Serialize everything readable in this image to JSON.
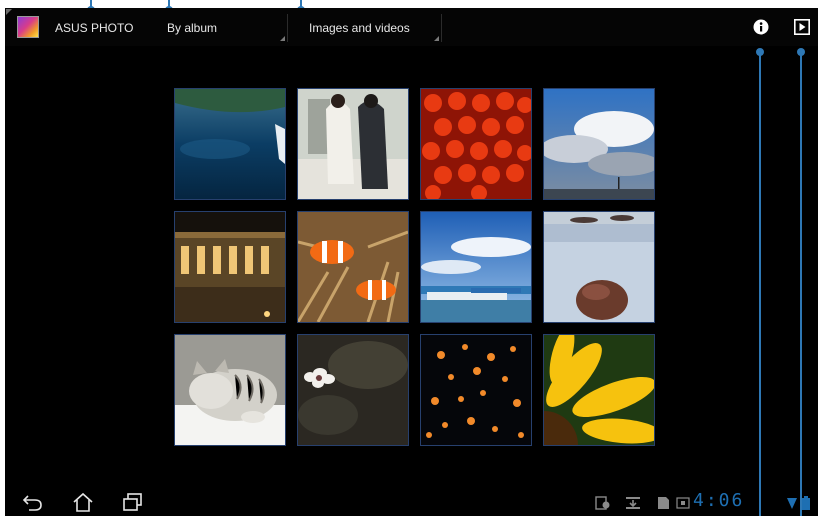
{
  "app": {
    "title": "ASUS PHOTO",
    "view_spinner_label": "By album",
    "filter_spinner_label": "Images and videos"
  },
  "icons": {
    "app": "asus-photo-app-icon",
    "info": "info-icon",
    "slideshow": "play-slideshow-icon",
    "back": "back-icon",
    "home": "home-icon",
    "recent": "recent-apps-icon",
    "notif_screenshot": "screenshot-notification-icon",
    "notif_download": "download-icon",
    "notif_sdcard": "sd-card-icon",
    "notif_keyboard": "keyboard-icon",
    "wifi": "wifi-icon",
    "battery": "battery-icon"
  },
  "thumbnails": [
    "lake-boat",
    "couple-walking",
    "red-lanterns",
    "cloudy-sky",
    "lit-building-night",
    "clownfish-anemone",
    "harbor-boats",
    "sea-rock",
    "sleeping-kitten",
    "white-flower",
    "floating-lanterns",
    "yellow-sunflower"
  ],
  "status_bar": {
    "time": "4:06"
  },
  "colors": {
    "screen_bg": "#000000",
    "accent_blue": "#1e6fb2",
    "callout_blue": "#2e78b5",
    "thumb_border": "#27406e"
  }
}
